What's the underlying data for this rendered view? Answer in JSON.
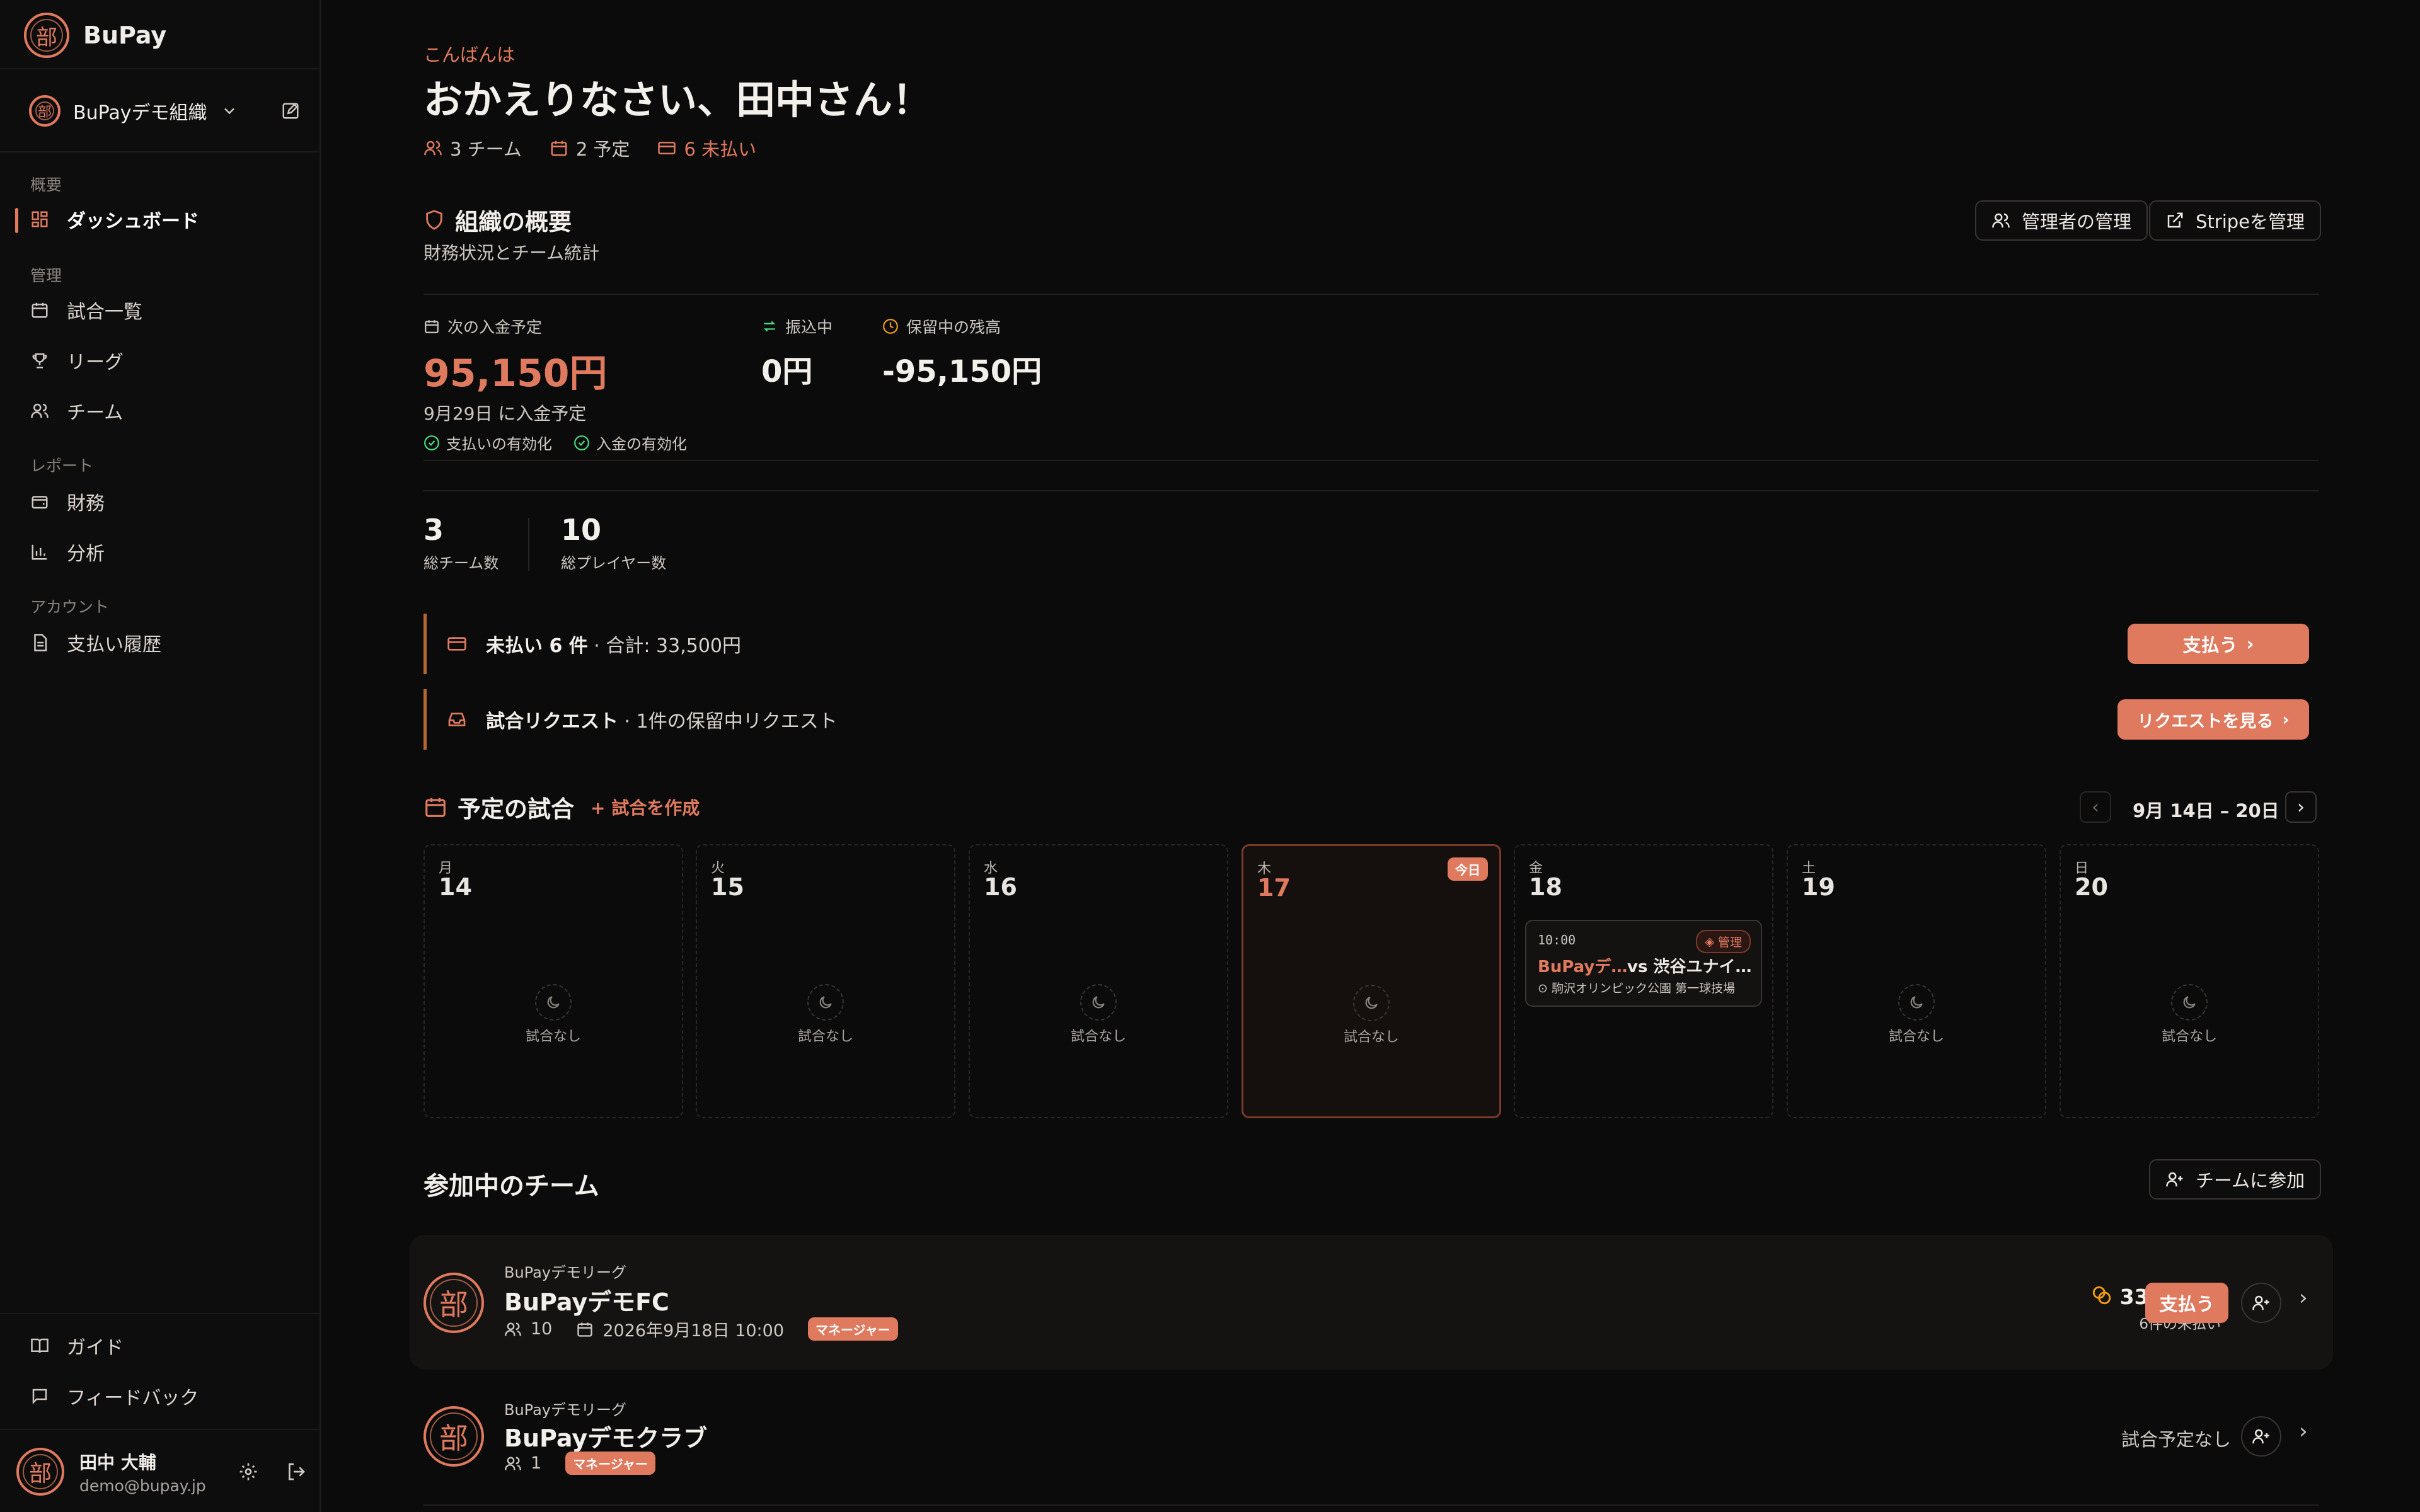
{
  "app": {
    "name": "BuPay",
    "seal_char": "部"
  },
  "org": {
    "name": "BuPayデモ組織"
  },
  "sidebar": {
    "sections": [
      {
        "label": "概要"
      },
      {
        "label": "管理"
      },
      {
        "label": "レポート"
      },
      {
        "label": "アカウント"
      }
    ],
    "items": [
      {
        "label": "ダッシュボード",
        "icon": "dashboard-icon"
      },
      {
        "label": "試合一覧",
        "icon": "calendar-icon"
      },
      {
        "label": "リーグ",
        "icon": "trophy-icon"
      },
      {
        "label": "チーム",
        "icon": "users-icon"
      },
      {
        "label": "財務",
        "icon": "wallet-icon"
      },
      {
        "label": "分析",
        "icon": "bar-chart-icon"
      },
      {
        "label": "支払い履歴",
        "icon": "document-icon"
      }
    ],
    "footer": [
      {
        "label": "ガイド",
        "icon": "book-icon"
      },
      {
        "label": "フィードバック",
        "icon": "message-icon"
      }
    ]
  },
  "user": {
    "name": "田中 大輔",
    "email": "demo@bupay.jp"
  },
  "greeting": {
    "small": "こんばんは",
    "title": "おかえりなさい、田中さん！"
  },
  "summary": {
    "teams": "3 チーム",
    "events": "2 予定",
    "unpaid": "6 未払い"
  },
  "overview": {
    "title": "組織の概要",
    "subtitle": "財務状況とチーム統計",
    "manage_admins": "管理者の管理",
    "manage_stripe": "Stripeを管理",
    "next_payout_label": "次の入金予定",
    "next_payout_value": "95,150円",
    "next_payout_date": "9月29日 に入金予定",
    "payments_enabled": "支払いの有効化",
    "deposits_enabled": "入金の有効化",
    "transfer_label": "振込中",
    "transfer_value": "0円",
    "held_label": "保留中の残高",
    "held_value": "-95,150円",
    "total_teams_value": "3",
    "total_teams_label": "総チーム数",
    "total_players_value": "10",
    "total_players_label": "総プレイヤー数"
  },
  "alerts": {
    "unpaid_title": "未払い 6 件",
    "unpaid_detail": " · 合計: 33,500円",
    "unpaid_button": "支払う",
    "requests_title": "試合リクエスト",
    "requests_detail": " · 1件の保留中リクエスト",
    "requests_button": "リクエストを見る"
  },
  "schedule": {
    "title": "予定の試合",
    "create": "+ 試合を作成",
    "range": "9月 14日 – 20日",
    "empty": "試合なし",
    "today_badge": "今日",
    "days": [
      {
        "dow": "月",
        "num": "14"
      },
      {
        "dow": "火",
        "num": "15"
      },
      {
        "dow": "水",
        "num": "16"
      },
      {
        "dow": "木",
        "num": "17"
      },
      {
        "dow": "金",
        "num": "18"
      },
      {
        "dow": "土",
        "num": "19"
      },
      {
        "dow": "日",
        "num": "20"
      }
    ],
    "match": {
      "time": "10:00",
      "badge": "管理",
      "home": "BuPayデ…",
      "vs": "vs 渋谷ユナイ…",
      "venue": "駒沢オリンピック公園 第一球技場"
    }
  },
  "teams": {
    "title": "参加中のチーム",
    "join": "チームに参加",
    "list": [
      {
        "league": "BuPayデモリーグ",
        "name": "BuPayデモFC",
        "members": "10",
        "date": "2026年9月18日 10:00",
        "role": "マネージャー",
        "amount": "33,500円",
        "unpaid": "6件の未払い",
        "pay": "支払う"
      },
      {
        "league": "BuPayデモリーグ",
        "name": "BuPayデモクラブ",
        "members": "1",
        "role": "マネージャー",
        "no_events": "試合予定なし"
      }
    ]
  },
  "colors": {
    "accent": "#e07a5f",
    "green": "#4ade80",
    "background": "#0b0b0b"
  }
}
